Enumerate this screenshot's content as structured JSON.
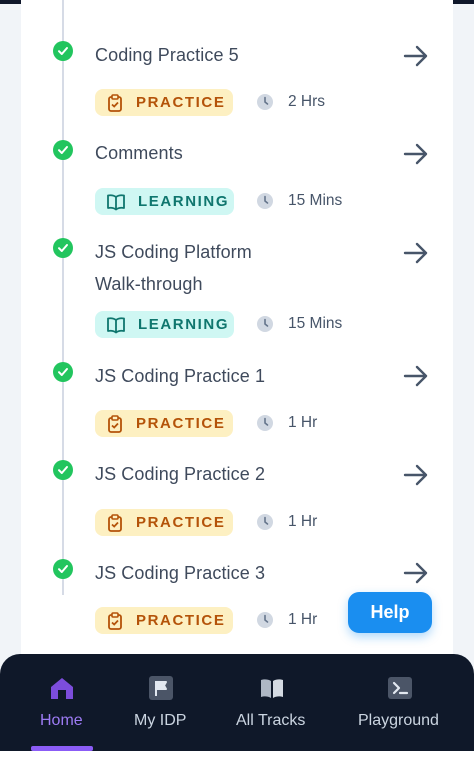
{
  "items": [
    {
      "title": "Coding Practice 5",
      "type": "PRACTICE",
      "duration": "2 Hrs"
    },
    {
      "title": "Comments",
      "type": "LEARNING",
      "duration": "15 Mins"
    },
    {
      "title_line1": "JS Coding Platform",
      "title_line2": "Walk-through",
      "type": "LEARNING",
      "duration": "15 Mins"
    },
    {
      "title": "JS Coding Practice 1",
      "type": "PRACTICE",
      "duration": "1 Hr"
    },
    {
      "title": "JS Coding Practice 2",
      "type": "PRACTICE",
      "duration": "1 Hr"
    },
    {
      "title": "JS Coding Practice 3",
      "type": "PRACTICE",
      "duration": "1 Hr"
    }
  ],
  "help": {
    "label": "Help"
  },
  "nav": {
    "items": [
      {
        "label": "Home",
        "icon": "home-icon",
        "active": true
      },
      {
        "label": "My IDP",
        "icon": "flag-icon",
        "active": false
      },
      {
        "label": "All Tracks",
        "icon": "book-open-icon",
        "active": false
      },
      {
        "label": "Playground",
        "icon": "terminal-icon",
        "active": false
      }
    ]
  },
  "colors": {
    "complete": "#22c55e",
    "practice_bg": "#fdf0c2",
    "practice_fg": "#b45309",
    "learning_bg": "#cff7f3",
    "learning_fg": "#0f766e",
    "help_button": "#1a8ef0",
    "nav_bg": "#0f1829",
    "nav_active": "#8b5cf6"
  }
}
